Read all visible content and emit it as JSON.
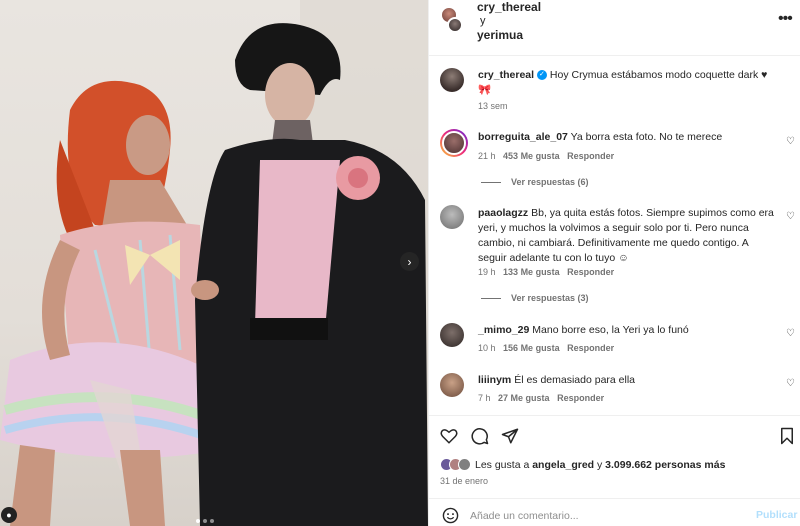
{
  "header": {
    "user1": "cry_thereal",
    "conjunction": "y",
    "user2": "yerimua",
    "menu_icon": "more-horizontal-icon"
  },
  "caption": {
    "username": "cry_thereal",
    "verified_icon": "verified-badge-icon",
    "text": "Hoy Crymua estábamos modo coquette dark ♥",
    "emoji": "🎀",
    "time": "13 sem"
  },
  "comments": [
    {
      "username": "borreguita_ale_07",
      "text": "Ya borra esta foto. No te merece",
      "time": "21 h",
      "likes": "453 Me gusta",
      "reply_label": "Responder",
      "view_replies": "Ver respuestas (6)"
    },
    {
      "username": "paaolagzz",
      "text": "Bb, ya quita estás fotos. Siempre supimos como era yeri, y muchos la volvimos a seguir solo por ti. Pero nunca cambio, ni cambiará. Definitivamente me quedo contigo. A seguir adelante tu con lo tuyo ☺",
      "time": "19 h",
      "likes": "133 Me gusta",
      "reply_label": "Responder",
      "view_replies": "Ver respuestas (3)"
    },
    {
      "username": "_mimo_29",
      "text": "Mano borre eso, la Yeri ya lo funó",
      "time": "10 h",
      "likes": "156 Me gusta",
      "reply_label": "Responder"
    },
    {
      "username": "liiinym",
      "text": "Él es demasiado para ella",
      "time": "7 h",
      "likes": "27 Me gusta",
      "reply_label": "Responder"
    }
  ],
  "likes": {
    "prefix": "Les gusta a",
    "user": "angela_gred",
    "middle": "y",
    "count": "3.099.662 personas más"
  },
  "date": "31 de enero",
  "comment_box": {
    "placeholder": "Añade un comentario...",
    "publish_label": "Publicar"
  },
  "colors": {
    "text": "#262626",
    "muted": "#737373",
    "link_disabled": "#b2dffc",
    "border": "#efefef"
  }
}
